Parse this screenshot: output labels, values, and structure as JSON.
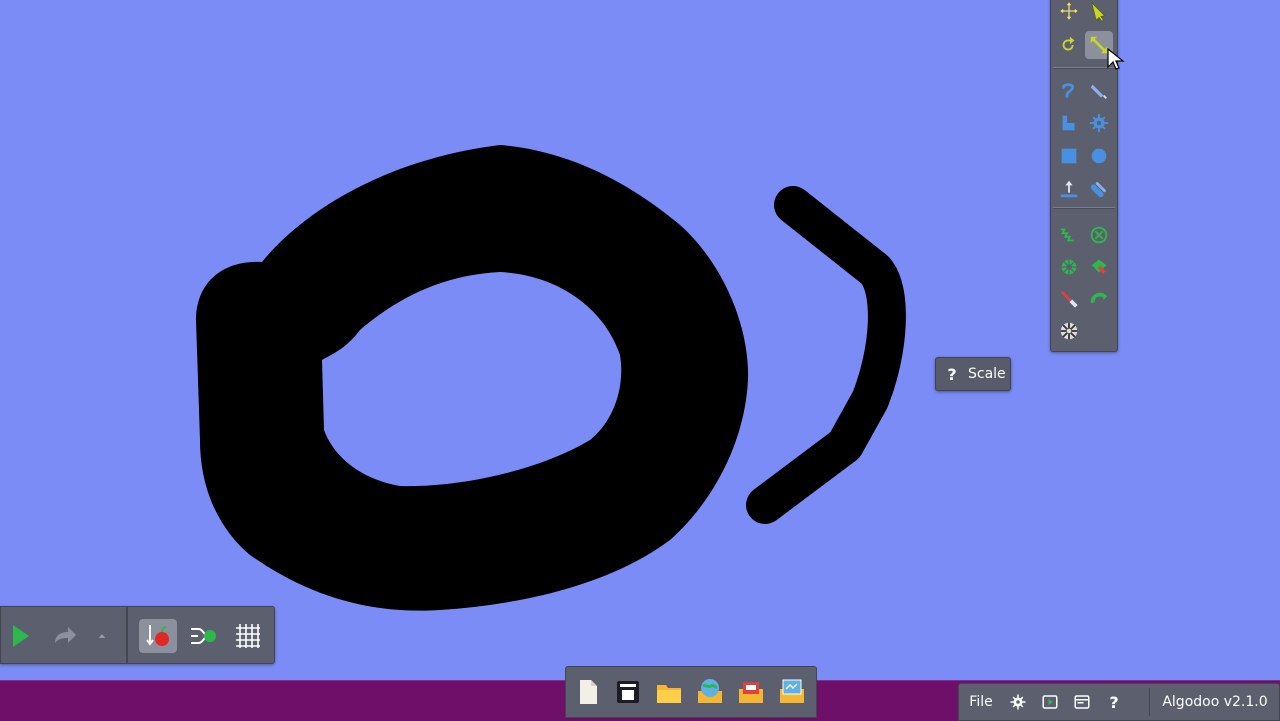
{
  "app": {
    "name": "Algodoo",
    "version_label": "Algodoo v2.1.0"
  },
  "tooltip": {
    "icon": "question-icon",
    "text": "Scale"
  },
  "menu": {
    "file_label": "File"
  },
  "toolbox": {
    "tools": [
      {
        "id": "move",
        "icon": "move-icon",
        "active": false
      },
      {
        "id": "drag",
        "icon": "drag-icon",
        "active": false
      },
      {
        "id": "rotate",
        "icon": "rotate-icon",
        "active": false
      },
      {
        "id": "scale",
        "icon": "scale-icon",
        "active": true
      },
      {
        "id": "sketch",
        "icon": "sketch-icon",
        "active": false
      },
      {
        "id": "cut",
        "icon": "knife-icon",
        "active": false
      },
      {
        "id": "brush",
        "icon": "brush-icon",
        "active": false
      },
      {
        "id": "gear",
        "icon": "gear-icon",
        "active": false
      },
      {
        "id": "box",
        "icon": "box-icon",
        "active": false
      },
      {
        "id": "circle",
        "icon": "circle-icon",
        "active": false
      },
      {
        "id": "plane",
        "icon": "plane-icon",
        "active": false
      },
      {
        "id": "chain",
        "icon": "chain-icon",
        "active": false
      },
      {
        "id": "spring",
        "icon": "spring-icon",
        "active": false
      },
      {
        "id": "fixate",
        "icon": "fixate-icon",
        "active": false
      },
      {
        "id": "axle",
        "icon": "axle-icon",
        "active": false
      },
      {
        "id": "thruster",
        "icon": "thruster-icon",
        "active": false
      },
      {
        "id": "laser",
        "icon": "laser-icon",
        "active": false
      },
      {
        "id": "tracer",
        "icon": "tracer-icon",
        "active": false
      },
      {
        "id": "texture",
        "icon": "texture-icon",
        "active": false
      }
    ]
  },
  "colors": {
    "canvas": "#7b8cf6",
    "shape": "#000000",
    "accent": "#2db84d",
    "bottom_bar": "#6e0f6a",
    "panel": "#5c5f6e"
  }
}
